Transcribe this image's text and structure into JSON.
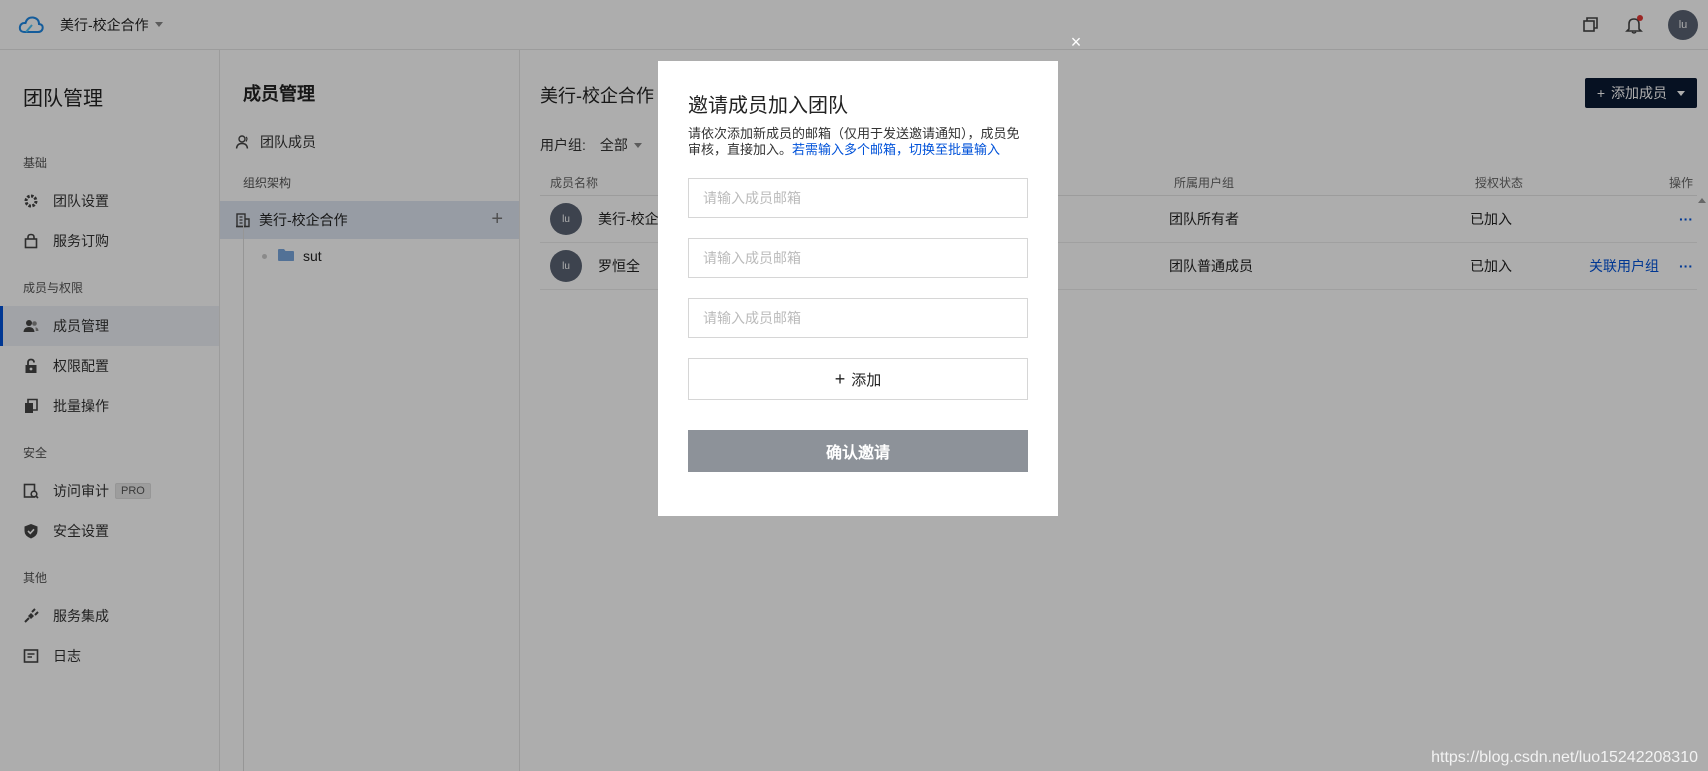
{
  "topbar": {
    "team_name": "美行-校企合作",
    "avatar_text": "lu"
  },
  "sidebar": {
    "title": "团队管理",
    "sections": [
      {
        "label": "基础",
        "items": [
          {
            "label": "团队设置",
            "icon": "gear-icon"
          },
          {
            "label": "服务订购",
            "icon": "bag-icon"
          }
        ]
      },
      {
        "label": "成员与权限",
        "items": [
          {
            "label": "成员管理",
            "icon": "users-icon",
            "active": true
          },
          {
            "label": "权限配置",
            "icon": "lock-icon"
          },
          {
            "label": "批量操作",
            "icon": "copy-icon"
          }
        ]
      },
      {
        "label": "安全",
        "items": [
          {
            "label": "访问审计",
            "icon": "audit-icon",
            "badge": "PRO"
          },
          {
            "label": "安全设置",
            "icon": "shield-icon"
          }
        ]
      },
      {
        "label": "其他",
        "items": [
          {
            "label": "服务集成",
            "icon": "plug-icon"
          },
          {
            "label": "日志",
            "icon": "log-icon"
          }
        ]
      }
    ]
  },
  "middle": {
    "title": "成员管理",
    "team_members_label": "团队成员",
    "org_label": "组织架构",
    "org_root": "美行-校企合作",
    "org_children": [
      "sut"
    ]
  },
  "main": {
    "title": "美行-校企合作",
    "add_member_label": "添加成员",
    "filter_label": "用户组:",
    "filter_value": "全部",
    "columns": {
      "name": "成员名称",
      "group": "所属用户组",
      "status": "授权状态",
      "op": "操作"
    },
    "rows": [
      {
        "avatar": "lu",
        "name": "美行-校企",
        "group": "团队所有者",
        "status": "已加入",
        "link": "",
        "more": "···"
      },
      {
        "avatar": "lu",
        "name": "罗恒全",
        "group": "团队普通成员",
        "status": "已加入",
        "link": "关联用户组",
        "more": "···"
      }
    ]
  },
  "modal": {
    "close": "×",
    "title": "邀请成员加入团队",
    "desc_text": "请依次添加新成员的邮箱（仅用于发送邀请通知），成员免审核，直接加入。",
    "desc_link": "若需输入多个邮箱，切换至批量输入",
    "inputs": [
      {
        "placeholder": "请输入成员邮箱",
        "value": ""
      },
      {
        "placeholder": "请输入成员邮箱",
        "value": ""
      },
      {
        "placeholder": "请输入成员邮箱",
        "value": ""
      }
    ],
    "add_label": "添加",
    "add_icon": "+",
    "confirm_label": "确认邀请"
  },
  "watermark": "https://blog.csdn.net/luo15242208310"
}
